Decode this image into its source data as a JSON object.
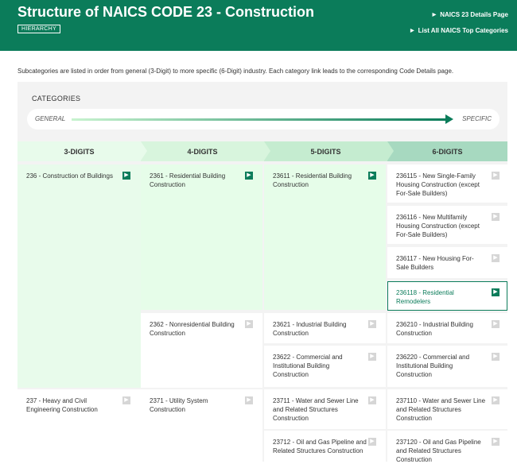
{
  "header": {
    "title": "Structure of NAICS CODE 23 - Construction",
    "badge": "HIERARCHY",
    "links": [
      "NAICS 23 Details Page",
      "List All NAICS Top Categories"
    ]
  },
  "intro": "Subcategories are listed in order from general (3-Digit) to more specific (6-Digit) industry. Each category link leads to the corresponding Code Details page.",
  "categories": {
    "label": "CATEGORIES",
    "general": "GENERAL",
    "specific": "SPECIFIC"
  },
  "columns": [
    "3-DIGITS",
    "4-DIGITS",
    "5-DIGITS",
    "6-DIGITS"
  ],
  "colors": {
    "brand": "#0b7c5a",
    "col1": "#e8fbeb",
    "col2": "#d8f5dd",
    "col3": "#c5ecd0",
    "col4": "#a7d9c0",
    "active_cell": "#e6fde9"
  },
  "level3": [
    {
      "text": "236 - Construction of Buildings",
      "active": true
    },
    {
      "text": "237 - Heavy and Civil Engineering Construction",
      "active": false
    }
  ],
  "level4": [
    {
      "text": "2361 - Residential Building Construction",
      "active": true
    },
    {
      "text": "2362 - Nonresidential Building Construction",
      "active": false
    },
    {
      "text": "2371 - Utility System Construction",
      "active": false
    }
  ],
  "level5": [
    {
      "text": "23611 - Residential Building Construction",
      "active": true
    },
    {
      "text": "23621 - Industrial Building Construction",
      "active": false
    },
    {
      "text": "23622 - Commercial and Institutional Building Construction",
      "active": false
    },
    {
      "text": "23711 - Water and Sewer Line and Related Structures Construction",
      "active": false
    },
    {
      "text": "23712 - Oil and Gas Pipeline and Related Structures Construction",
      "active": false
    }
  ],
  "level6": [
    {
      "text": "236115 - New Single-Family Housing Construction (except For-Sale Builders)",
      "active": false
    },
    {
      "text": "236116 - New Multifamily Housing Construction (except For-Sale Builders)",
      "active": false
    },
    {
      "text": "236117 - New Housing For-Sale Builders",
      "active": false
    },
    {
      "text": "236118 - Residential Remodelers",
      "active": true
    },
    {
      "text": "236210 - Industrial Building Construction",
      "active": false
    },
    {
      "text": "236220 - Commercial and Institutional Building Construction",
      "active": false
    },
    {
      "text": "237110 - Water and Sewer Line and Related Structures Construction",
      "active": false
    },
    {
      "text": "237120 - Oil and Gas Pipeline and Related Structures Construction",
      "active": false
    }
  ]
}
